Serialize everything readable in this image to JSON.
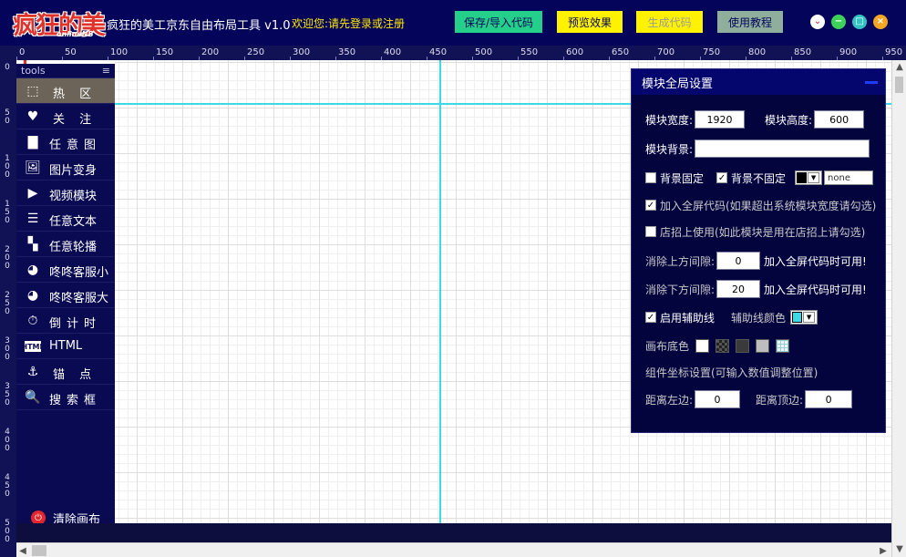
{
  "titlebar": {
    "logo_text": "疯狂的美工",
    "logo_sub": "onlineNB",
    "app_title": "疯狂的美工京东自由布局工具 v1.0",
    "welcome": "欢迎您:请先登录或注册",
    "buttons": {
      "save": "保存/导入代码",
      "preview": "预览效果",
      "generate": "生成代码",
      "tutorial": "使用教程"
    },
    "window_controls": {
      "menu": "⌄",
      "minimize": "−",
      "maximize": "□",
      "close": "×"
    }
  },
  "ruler": {
    "horizontal": [
      "0",
      "50",
      "100",
      "150",
      "200",
      "250",
      "300",
      "350",
      "400",
      "450",
      "500",
      "550",
      "600",
      "650",
      "700",
      "750",
      "800",
      "850",
      "900",
      "950"
    ],
    "vertical": [
      "0",
      "50",
      "100",
      "150",
      "200",
      "250",
      "300",
      "350",
      "400",
      "450",
      "500"
    ]
  },
  "tools": {
    "header": "tools",
    "collapse_icon": "≡",
    "items": [
      {
        "label": "热 区",
        "icon": "hotzone-icon",
        "glyph": "⬚"
      },
      {
        "label": "关 注",
        "icon": "heart-icon",
        "glyph": "♥"
      },
      {
        "label": "任意图",
        "icon": "image-icon",
        "glyph": "▇"
      },
      {
        "label": "图片变身",
        "icon": "picture-icon",
        "glyph": "🖼"
      },
      {
        "label": "视频模块",
        "icon": "play-icon",
        "glyph": "▶"
      },
      {
        "label": "任意文本",
        "icon": "text-icon",
        "glyph": "☰"
      },
      {
        "label": "任意轮播",
        "icon": "carousel-icon",
        "glyph": "▚"
      },
      {
        "label": "咚咚客服小",
        "icon": "chat-icon",
        "glyph": "◕"
      },
      {
        "label": "咚咚客服大",
        "icon": "chat-icon",
        "glyph": "◕"
      },
      {
        "label": "倒计时",
        "icon": "timer-icon",
        "glyph": "⏱"
      },
      {
        "label": "HTML",
        "icon": "html-icon",
        "glyph": "HTML"
      },
      {
        "label": "锚 点",
        "icon": "anchor-icon",
        "glyph": "⚓"
      },
      {
        "label": "搜索框",
        "icon": "search-icon",
        "glyph": "🔍"
      }
    ],
    "clear_label": "清除画布"
  },
  "panel": {
    "title": "模块全局设置",
    "width_label": "模块宽度:",
    "width_value": "1920",
    "height_label": "模块高度:",
    "height_value": "600",
    "bg_label": "模块背景:",
    "bg_value": "",
    "bg_fixed_label": "背景固定",
    "bg_fixed_checked": false,
    "bg_unfixed_label": "背景不固定",
    "bg_unfixed_checked": true,
    "bg_color_value": "none",
    "fullscreen_label": "加入全屏代码(如果超出系统模块宽度请勾选)",
    "fullscreen_checked": true,
    "shopsign_label": "店招上使用(如此模块是用在店招上请勾选)",
    "shopsign_checked": false,
    "remove_top_label": "消除上方间隙:",
    "remove_top_value": "0",
    "remove_top_note": "加入全屏代码时可用!",
    "remove_bottom_label": "消除下方间隙:",
    "remove_bottom_value": "20",
    "remove_bottom_note": "加入全屏代码时可用!",
    "guides_label": "启用辅助线",
    "guides_checked": true,
    "guide_color_label": "辅助线颜色",
    "guide_color": "#3fd9e6",
    "canvas_bg_label": "画布底色",
    "coord_label": "组件坐标设置(可输入数值调整位置)",
    "left_label": "距离左边:",
    "left_value": "0",
    "top_label": "距离顶边:",
    "top_value": "0"
  },
  "colors": {
    "accent": "#04045a",
    "guide": "#3fd9e6",
    "save_button": "#24cf8a",
    "preview_button": "#fff200",
    "clear_dot": "#e3262d"
  }
}
